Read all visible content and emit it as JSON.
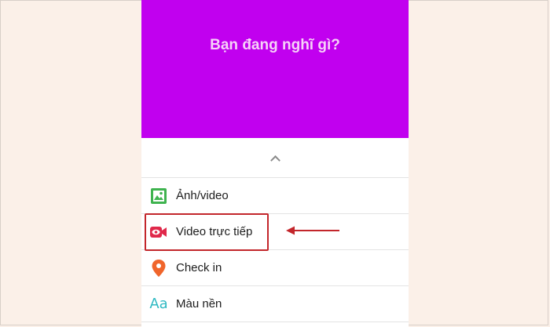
{
  "composer": {
    "prompt": "Bạn đang nghĩ gì?"
  },
  "options": [
    {
      "label": "Ảnh/video",
      "icon": "photo-gallery-icon"
    },
    {
      "label": "Video trực tiếp",
      "icon": "live-video-icon"
    },
    {
      "label": "Check in",
      "icon": "location-pin-icon"
    },
    {
      "label": "Màu nền",
      "icon": "text-background-icon",
      "icon_text": "Aa"
    }
  ],
  "colors": {
    "composer_bg": "#c100ef",
    "highlight": "#c3262b",
    "photo_icon": "#3fb34f",
    "live_icon": "#e0284a",
    "checkin_icon": "#f0652b",
    "background_icon": "#2fb9c2"
  }
}
